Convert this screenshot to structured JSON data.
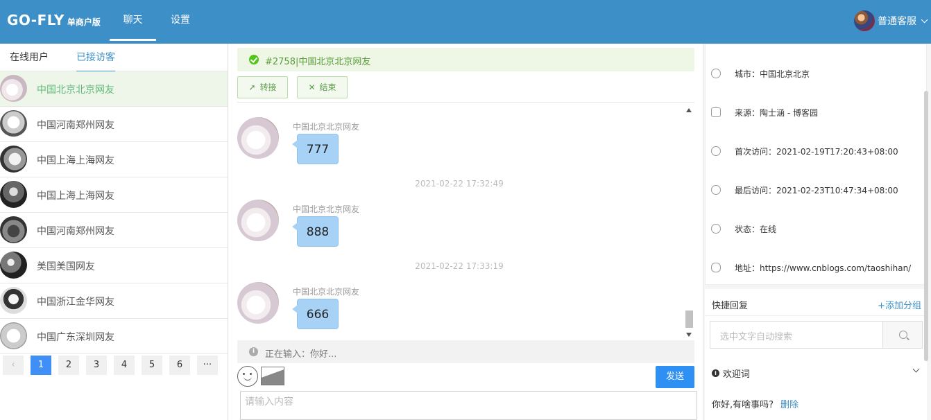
{
  "app": {
    "logo": "GO-FLY",
    "edition": "单商户版",
    "nav": [
      "聊天",
      "设置"
    ],
    "user_name": "普通客服"
  },
  "left": {
    "tabs": [
      "在线用户",
      "已接访客"
    ],
    "visitors": [
      "中国北京北京网友",
      "中国河南郑州网友",
      "中国上海上海网友",
      "中国上海上海网友",
      "中国河南郑州网友",
      "美国美国网友",
      "中国浙江金华网友",
      "中国广东深圳网友"
    ],
    "pager": {
      "prev": "‹",
      "pages": [
        "1",
        "2",
        "3",
        "4",
        "5",
        "6"
      ],
      "ellipsis": "···",
      "current": "1"
    }
  },
  "chat": {
    "title": "#2758|中国北京北京网友",
    "transfer": "转接",
    "end": "结束",
    "messages": [
      {
        "time": "",
        "name": "中国北京北京网友",
        "text": "777"
      },
      {
        "time": "2021-02-22 17:32:49",
        "name": "中国北京北京网友",
        "text": "888"
      },
      {
        "time": "2021-02-22 17:33:19",
        "name": "中国北京北京网友",
        "text": "666"
      }
    ],
    "typing": "正在输入：你好...",
    "send": "发送",
    "input_placeholder": "请输入内容"
  },
  "info": {
    "city": "城市：中国北京北京",
    "source": "来源：陶士涵 - 博客园",
    "first_visit": "首次访问：2021-02-19T17:20:43+08:00",
    "last_visit": "最后访问：2021-02-23T10:47:34+08:00",
    "status": "状态：在线",
    "address": "地址：https://www.cnblogs.com/taoshihan/"
  },
  "quick_reply": {
    "title": "快捷回复",
    "add_group": "+添加分组",
    "search_placeholder": "选中文字自动搜索",
    "group": "欢迎词",
    "reply": "你好,有啥事吗?",
    "delete": "删除"
  },
  "colors": {
    "header": "#3c8fc7",
    "accent_green": "#5fb878",
    "bubble": "#a7d2f5",
    "send_button": "#2f90f4"
  }
}
